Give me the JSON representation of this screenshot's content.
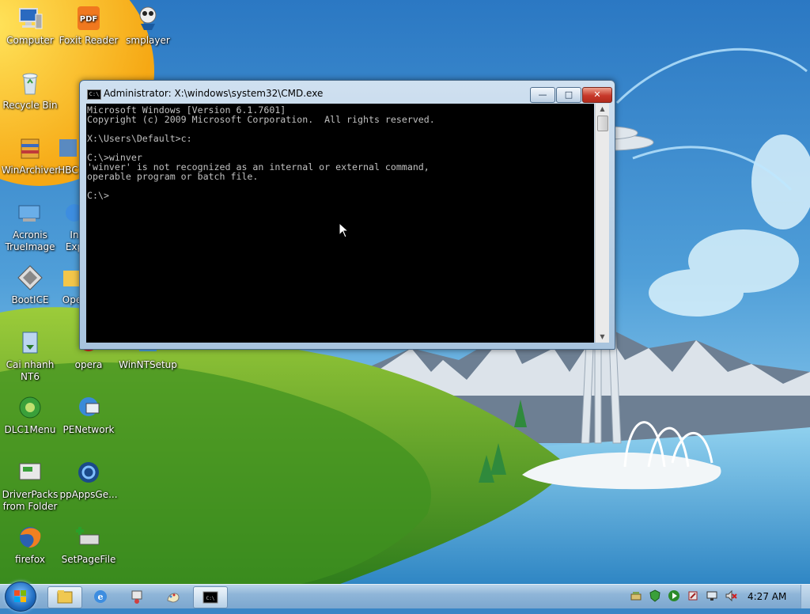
{
  "desktop": {
    "icons": [
      {
        "label": "Computer",
        "icon": "computer-icon"
      },
      {
        "label": "Foxit Reader",
        "icon": "pdf-reader-icon"
      },
      {
        "label": "smplayer",
        "icon": "media-player-icon"
      },
      {
        "label": "Recycle Bin",
        "icon": "recycle-bin-icon"
      },
      {
        "label": "WinArchiver",
        "icon": "archiver-icon"
      },
      {
        "label": "HBC",
        "icon": "hbcd-icon"
      },
      {
        "label": "Acronis\nTrueImage",
        "icon": "acronis-icon"
      },
      {
        "label": "In\nExp",
        "icon": "internet-explorer-icon"
      },
      {
        "label": "BootICE",
        "icon": "bootice-icon"
      },
      {
        "label": "Ope",
        "icon": "open-icon"
      },
      {
        "label": "Cai nhanh\nNT6",
        "icon": "installer-icon"
      },
      {
        "label": "opera",
        "icon": "opera-icon"
      },
      {
        "label": "WinNTSetup",
        "icon": "winntsetup-icon"
      },
      {
        "label": "DLC1Menu",
        "icon": "dlc-menu-icon"
      },
      {
        "label": "PENetwork",
        "icon": "network-icon"
      },
      {
        "label": "DriverPacks\nfrom Folder",
        "icon": "driverpacks-icon"
      },
      {
        "label": "ppAppsGe...",
        "icon": "ppapps-icon"
      },
      {
        "label": "firefox",
        "icon": "firefox-icon"
      },
      {
        "label": "SetPageFile",
        "icon": "setpagefile-icon"
      }
    ]
  },
  "cmd_window": {
    "title": "Administrator: X:\\windows\\system32\\CMD.exe",
    "icon_text": "C:\\",
    "minimize_label": "—",
    "maximize_label": "□",
    "close_label": "✕",
    "lines": [
      "Microsoft Windows [Version 6.1.7601]",
      "Copyright (c) 2009 Microsoft Corporation.  All rights reserved.",
      "",
      "X:\\Users\\Default>c:",
      "",
      "C:\\>winver",
      "'winver' is not recognized as an internal or external command,",
      "operable program or batch file.",
      "",
      "C:\\>"
    ]
  },
  "taskbar": {
    "pinned": [
      "explorer-icon",
      "internet-explorer-icon",
      "network-icon",
      "paint-icon",
      "cmd-icon"
    ],
    "tray_icons": [
      "network-tray-icon",
      "shield-tray-icon",
      "media-tray-icon",
      "settings-tray-icon",
      "monitor-tray-icon",
      "volume-muted-icon"
    ],
    "clock": "4:27 AM"
  },
  "colors": {
    "console_bg": "#000000",
    "console_fg": "#c0c0c0",
    "close_button": "#c7382a"
  }
}
